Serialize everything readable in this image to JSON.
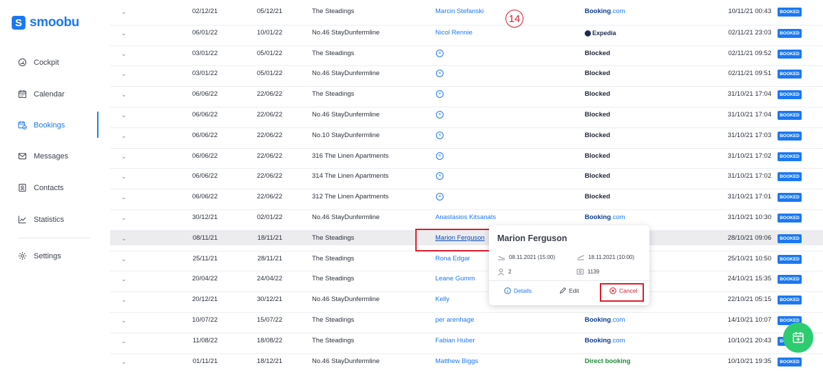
{
  "brand": {
    "logo_letter": "S",
    "name": "smoobu",
    "color": "#1b78f2"
  },
  "nav": {
    "cockpit": "Cockpit",
    "calendar": "Calendar",
    "bookings": "Bookings",
    "messages": "Messages",
    "contacts": "Contacts",
    "statistics": "Statistics",
    "settings": "Settings"
  },
  "rows": [
    {
      "arrival": "02/12/21",
      "departure": "05/12/21",
      "apartment": "The Steadings",
      "guest": "Marcin Stefanski",
      "channel": "Booking",
      "channel_suffix": ".com",
      "channel_type": "booking",
      "created": "10/11/21 00:43",
      "status": "BOOKED"
    },
    {
      "arrival": "06/01/22",
      "departure": "10/01/22",
      "apartment": "No.46 StayDunfermline",
      "guest": "Nicol Rennie",
      "channel": "Expedia",
      "channel_suffix": "",
      "channel_type": "expedia",
      "created": "02/11/21 23:03",
      "status": "BOOKED"
    },
    {
      "arrival": "03/01/22",
      "departure": "05/01/22",
      "apartment": "The Steadings",
      "guest": "",
      "channel": "Blocked",
      "channel_suffix": "",
      "channel_type": "blocked",
      "created": "02/11/21 09:52",
      "status": "BOOKED"
    },
    {
      "arrival": "03/01/22",
      "departure": "05/01/22",
      "apartment": "No.46 StayDunfermline",
      "guest": "",
      "channel": "Blocked",
      "channel_suffix": "",
      "channel_type": "blocked",
      "created": "02/11/21 09:51",
      "status": "BOOKED"
    },
    {
      "arrival": "06/06/22",
      "departure": "22/06/22",
      "apartment": "The Steadings",
      "guest": "",
      "channel": "Blocked",
      "channel_suffix": "",
      "channel_type": "blocked",
      "created": "31/10/21 17:04",
      "status": "BOOKED"
    },
    {
      "arrival": "06/06/22",
      "departure": "22/06/22",
      "apartment": "No.46 StayDunfermline",
      "guest": "",
      "channel": "Blocked",
      "channel_suffix": "",
      "channel_type": "blocked",
      "created": "31/10/21 17:04",
      "status": "BOOKED"
    },
    {
      "arrival": "06/06/22",
      "departure": "22/06/22",
      "apartment": "No.10 StayDunfermline",
      "guest": "",
      "channel": "Blocked",
      "channel_suffix": "",
      "channel_type": "blocked",
      "created": "31/10/21 17:03",
      "status": "BOOKED"
    },
    {
      "arrival": "06/06/22",
      "departure": "22/06/22",
      "apartment": "316 The Linen Apartments",
      "guest": "",
      "channel": "Blocked",
      "channel_suffix": "",
      "channel_type": "blocked",
      "created": "31/10/21 17:02",
      "status": "BOOKED"
    },
    {
      "arrival": "06/06/22",
      "departure": "22/06/22",
      "apartment": "314 The Linen Apartments",
      "guest": "",
      "channel": "Blocked",
      "channel_suffix": "",
      "channel_type": "blocked",
      "created": "31/10/21 17:02",
      "status": "BOOKED"
    },
    {
      "arrival": "06/06/22",
      "departure": "22/06/22",
      "apartment": "312 The Linen Apartments",
      "guest": "",
      "channel": "Blocked",
      "channel_suffix": "",
      "channel_type": "blocked",
      "created": "31/10/21 17:01",
      "status": "BOOKED"
    },
    {
      "arrival": "30/12/21",
      "departure": "02/01/22",
      "apartment": "No.46 StayDunfermline",
      "guest": "Anastasios Kitsanats",
      "channel": "Booking",
      "channel_suffix": ".com",
      "channel_type": "booking",
      "created": "31/10/21 10:30",
      "status": "BOOKED"
    },
    {
      "arrival": "08/11/21",
      "departure": "18/11/21",
      "apartment": "The Steadings",
      "guest": "Marion Ferguson",
      "channel": "",
      "channel_suffix": "",
      "channel_type": "hidden",
      "created": "28/10/21 09:06",
      "status": "BOOKED",
      "highlighted": true
    },
    {
      "arrival": "25/11/21",
      "departure": "28/11/21",
      "apartment": "The Steadings",
      "guest": "Rona Edgar",
      "channel": "",
      "channel_suffix": "",
      "channel_type": "hidden",
      "created": "25/10/21 10:50",
      "status": "BOOKED"
    },
    {
      "arrival": "20/04/22",
      "departure": "24/04/22",
      "apartment": "The Steadings",
      "guest": "Leane Gumm",
      "channel": "",
      "channel_suffix": "",
      "channel_type": "hidden",
      "created": "24/10/21 15:35",
      "status": "BOOKED"
    },
    {
      "arrival": "20/12/21",
      "departure": "30/12/21",
      "apartment": "No.46 StayDunfermline",
      "guest": "Kelly",
      "channel": "",
      "channel_suffix": "",
      "channel_type": "hidden",
      "created": "22/10/21 05:15",
      "status": "BOOKED"
    },
    {
      "arrival": "10/07/22",
      "departure": "15/07/22",
      "apartment": "The Steadings",
      "guest": "per arenhage",
      "channel": "Booking",
      "channel_suffix": ".com",
      "channel_type": "booking",
      "created": "14/10/21 10:07",
      "status": "BOOKED"
    },
    {
      "arrival": "11/08/22",
      "departure": "18/08/22",
      "apartment": "The Steadings",
      "guest": "Fabian Huber",
      "channel": "Booking",
      "channel_suffix": ".com",
      "channel_type": "booking",
      "created": "10/10/21 20:43",
      "status": "BOOKED"
    },
    {
      "arrival": "01/11/21",
      "departure": "18/12/21",
      "apartment": "No.46 StayDunfermline",
      "guest": "Matthew Biggs",
      "channel": "Direct booking",
      "channel_suffix": "",
      "channel_type": "direct",
      "created": "10/10/21 19:35",
      "status": "BOOKED"
    }
  ],
  "popup": {
    "guest_name": "Marion Ferguson",
    "checkin": "08.11.2021 (15:00)",
    "checkout": "18.11.2021 (10:00)",
    "guests": "2",
    "price": "1139",
    "details_label": "Details",
    "edit_label": "Edit",
    "cancel_label": "Cancel"
  },
  "annotation": {
    "step_number": "14",
    "color": "#e0192b"
  }
}
